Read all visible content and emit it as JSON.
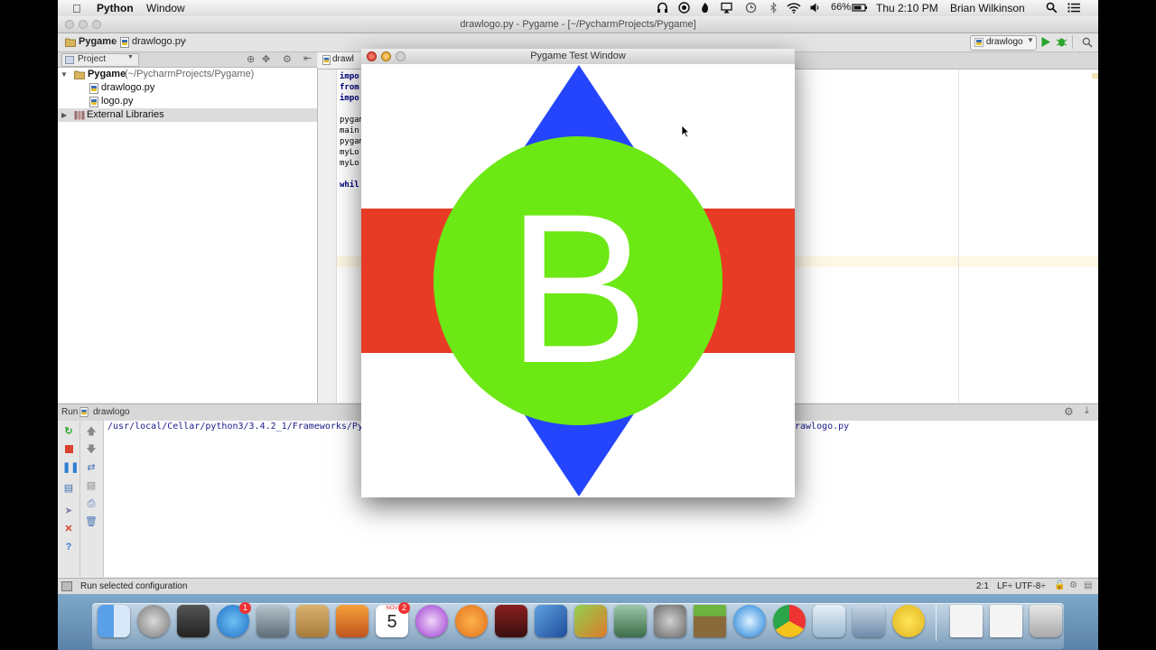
{
  "menubar": {
    "app_name": "Python",
    "menu_window": "Window",
    "battery": "66%",
    "clock": "Thu 2:10 PM",
    "user": "Brian Wilkinson"
  },
  "ide": {
    "window_title": "drawlogo.py - Pygame - [~/PycharmProjects/Pygame]",
    "breadcrumb": [
      "Pygame",
      "drawlogo.py"
    ],
    "run_config": "drawlogo",
    "project_panel_label": "Project",
    "tree": {
      "root_name": "Pygame",
      "root_path": "(~/PycharmProjects/Pygame)",
      "files": [
        "drawlogo.py",
        "logo.py"
      ],
      "external": "External Libraries"
    },
    "editor_tab": "drawl",
    "code_lines": [
      "impo",
      "from",
      "impo",
      "",
      "pygam",
      "main",
      "pygam",
      "myLo",
      "myLo",
      "",
      "whil"
    ],
    "run_panel": {
      "label": "Run",
      "config": "drawlogo",
      "output_path": "/usr/local/Cellar/python3/3.4.2_1/Frameworks/Pytho",
      "output_tail": "rawlogo.py"
    },
    "statusbar": {
      "message": "Run selected configuration",
      "position": "2:1",
      "line_sep": "LF÷",
      "encoding": "UTF-8÷"
    }
  },
  "pygame_window": {
    "title": "Pygame Test Window",
    "logo_letter": "B",
    "colors": {
      "background": "#ffffff",
      "diamond": "#2445fb",
      "band": "#e83b26",
      "circle": "#6ce815",
      "letter": "#ffffff"
    }
  },
  "dock": {
    "calendar_day": "5",
    "calendar_month": "NOV",
    "app_store_badge": "1",
    "calendar_badge": "2",
    "icons": [
      "finder-icon",
      "launchpad-icon",
      "photo-booth-icon",
      "app-store-icon",
      "facetime-icon",
      "contacts-icon",
      "notes-icon",
      "calendar-icon",
      "itunes-icon",
      "ibooks-icon",
      "photo-slides-icon",
      "xcode-icon",
      "app-icon",
      "image-capture-icon",
      "system-preferences-icon",
      "minecraft-icon",
      "quicktime-icon",
      "chrome-icon",
      "preview-icon",
      "iphoto-icon",
      "python-idle-icon",
      "document-icon",
      "document-icon",
      "trash-icon"
    ]
  }
}
